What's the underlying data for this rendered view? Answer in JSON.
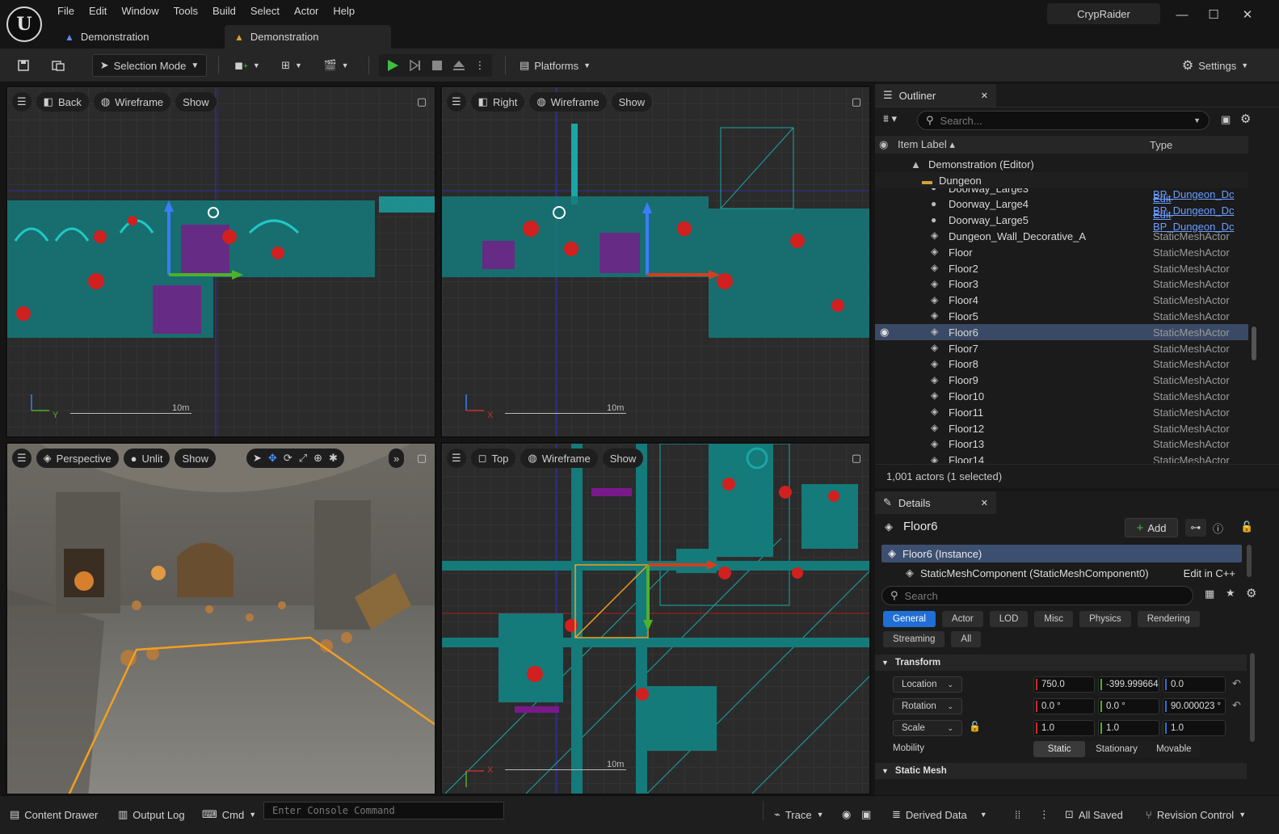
{
  "app": {
    "logo_letter": "U",
    "menu": [
      "File",
      "Edit",
      "Window",
      "Tools",
      "Build",
      "Select",
      "Actor",
      "Help"
    ],
    "tabs": [
      {
        "label": "Demonstration",
        "active": false
      },
      {
        "label": "Demonstration",
        "active": true
      }
    ],
    "project_name": "CrypRaider",
    "window_buttons": {
      "minimize": "—",
      "maximize": "☐",
      "close": "✕"
    }
  },
  "toolbar": {
    "selection_mode": "Selection Mode",
    "platforms": "Platforms",
    "settings": "Settings"
  },
  "viewports": {
    "top_left": {
      "view": "Back",
      "mode": "Wireframe",
      "show": "Show",
      "scale": "10m",
      "axis_a": "Z",
      "axis_b": "Y"
    },
    "top_right": {
      "view": "Right",
      "mode": "Wireframe",
      "show": "Show",
      "scale": "10m",
      "axis_a": "Z",
      "axis_b": "X"
    },
    "bottom_left": {
      "view": "Perspective",
      "mode": "Unlit",
      "show": "Show"
    },
    "bottom_right": {
      "view": "Top",
      "mode": "Wireframe",
      "show": "Show",
      "scale": "10m",
      "axis_a": "Y",
      "axis_b": "X"
    }
  },
  "outliner": {
    "title": "Outliner",
    "search_placeholder": "Search...",
    "col_label": "Item Label",
    "col_type": "Type",
    "root": "Demonstration (Editor)",
    "folder": "Dungeon",
    "rows": [
      {
        "label": "Doorway_Large3",
        "type": "Edit BP_Dungeon_Dc",
        "link": true,
        "icon": "bp"
      },
      {
        "label": "Doorway_Large4",
        "type": "Edit BP_Dungeon_Dc",
        "link": true,
        "icon": "bp"
      },
      {
        "label": "Doorway_Large5",
        "type": "Edit BP_Dungeon_Dc",
        "link": true,
        "icon": "bp"
      },
      {
        "label": "Dungeon_Wall_Decorative_A",
        "type": "StaticMeshActor",
        "link": false,
        "icon": "mesh"
      },
      {
        "label": "Floor",
        "type": "StaticMeshActor",
        "link": false,
        "icon": "mesh"
      },
      {
        "label": "Floor2",
        "type": "StaticMeshActor",
        "link": false,
        "icon": "mesh"
      },
      {
        "label": "Floor3",
        "type": "StaticMeshActor",
        "link": false,
        "icon": "mesh"
      },
      {
        "label": "Floor4",
        "type": "StaticMeshActor",
        "link": false,
        "icon": "mesh"
      },
      {
        "label": "Floor5",
        "type": "StaticMeshActor",
        "link": false,
        "icon": "mesh"
      },
      {
        "label": "Floor6",
        "type": "StaticMeshActor",
        "link": false,
        "icon": "mesh",
        "selected": true
      },
      {
        "label": "Floor7",
        "type": "StaticMeshActor",
        "link": false,
        "icon": "mesh"
      },
      {
        "label": "Floor8",
        "type": "StaticMeshActor",
        "link": false,
        "icon": "mesh"
      },
      {
        "label": "Floor9",
        "type": "StaticMeshActor",
        "link": false,
        "icon": "mesh"
      },
      {
        "label": "Floor10",
        "type": "StaticMeshActor",
        "link": false,
        "icon": "mesh"
      },
      {
        "label": "Floor11",
        "type": "StaticMeshActor",
        "link": false,
        "icon": "mesh"
      },
      {
        "label": "Floor12",
        "type": "StaticMeshActor",
        "link": false,
        "icon": "mesh"
      },
      {
        "label": "Floor13",
        "type": "StaticMeshActor",
        "link": false,
        "icon": "mesh"
      },
      {
        "label": "Floor14",
        "type": "StaticMeshActor",
        "link": false,
        "icon": "mesh"
      }
    ],
    "footer": "1,001 actors (1 selected)"
  },
  "details": {
    "title": "Details",
    "actor_name": "Floor6",
    "add_label": "Add",
    "instance": "Floor6 (Instance)",
    "component": "StaticMeshComponent (StaticMeshComponent0)",
    "edit_cpp": "Edit in C++",
    "search_placeholder": "Search",
    "categories": [
      "General",
      "Actor",
      "LOD",
      "Misc",
      "Physics",
      "Rendering",
      "Streaming",
      "All"
    ],
    "transform_header": "Transform",
    "location_label": "Location",
    "location": [
      "750.0",
      "-399.999664",
      "0.0"
    ],
    "rotation_label": "Rotation",
    "rotation": [
      "0.0 °",
      "0.0 °",
      "90.000023 °"
    ],
    "scale_label": "Scale",
    "scale": [
      "1.0",
      "1.0",
      "1.0"
    ],
    "mobility_label": "Mobility",
    "mobility_options": [
      "Static",
      "Stationary",
      "Movable"
    ],
    "static_mesh_header": "Static Mesh"
  },
  "statusbar": {
    "content_drawer": "Content Drawer",
    "output_log": "Output Log",
    "cmd": "Cmd",
    "console_placeholder": "Enter Console Command",
    "trace": "Trace",
    "derived_data": "Derived Data",
    "all_saved": "All Saved",
    "revision_control": "Revision Control"
  },
  "colors": {
    "accent_blue": "#1f6fd6",
    "wire_teal": "#1aa6a6",
    "play_green": "#3fbf3f",
    "link_blue": "#6b9cff"
  }
}
